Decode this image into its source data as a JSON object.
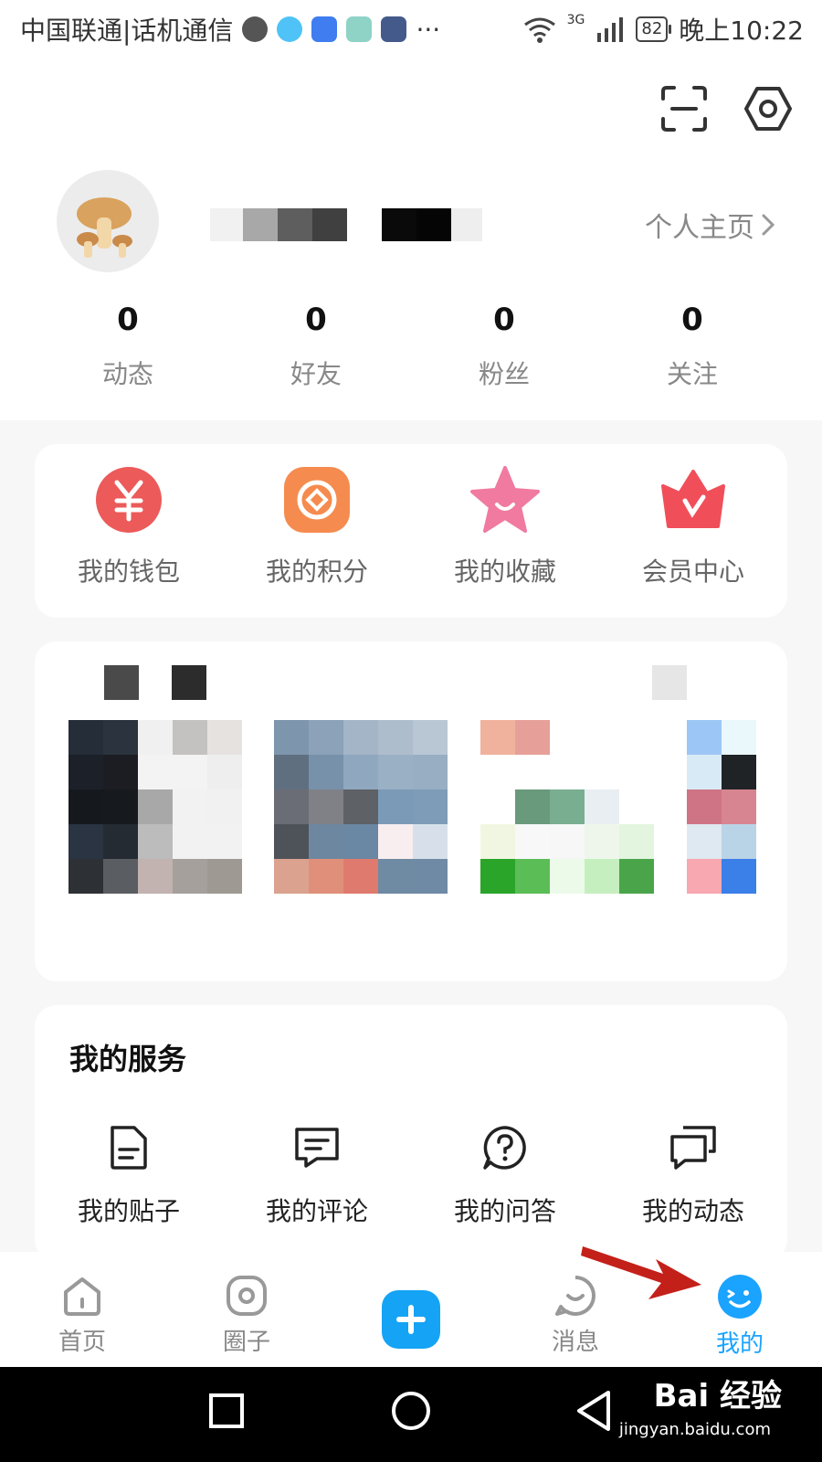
{
  "status_bar": {
    "carrier": "中国联通|话机通信",
    "more": "···",
    "network": "3G",
    "battery": "82",
    "time": "晚上10:22"
  },
  "profile": {
    "homepage_link": "个人主页",
    "stats": [
      {
        "value": "0",
        "label": "动态"
      },
      {
        "value": "0",
        "label": "好友"
      },
      {
        "value": "0",
        "label": "粉丝"
      },
      {
        "value": "0",
        "label": "关注"
      }
    ]
  },
  "quick_actions": [
    {
      "label": "我的钱包",
      "icon": "wallet-yen-icon",
      "color": "#ec5a5a"
    },
    {
      "label": "我的积分",
      "icon": "points-target-icon",
      "color": "#f58b4e"
    },
    {
      "label": "我的收藏",
      "icon": "favorites-star-icon",
      "color": "#f07aa0"
    },
    {
      "label": "会员中心",
      "icon": "vip-crown-icon",
      "color": "#f04f5a"
    }
  ],
  "services": {
    "title": "我的服务",
    "items": [
      {
        "label": "我的贴子",
        "icon": "document-icon"
      },
      {
        "label": "我的评论",
        "icon": "comment-icon"
      },
      {
        "label": "我的问答",
        "icon": "question-icon"
      },
      {
        "label": "我的动态",
        "icon": "feed-chat-icon"
      }
    ]
  },
  "tabbar": {
    "items": [
      {
        "label": "首页",
        "icon": "home-icon"
      },
      {
        "label": "圈子",
        "icon": "circle-icon"
      },
      {
        "label": "",
        "icon": "plus-icon"
      },
      {
        "label": "消息",
        "icon": "message-icon"
      },
      {
        "label": "我的",
        "icon": "profile-smile-icon"
      }
    ],
    "active_color": "#1aa3ff"
  },
  "watermark": {
    "brand": "Bai 经验",
    "url": "jingyan.baidu.com"
  }
}
